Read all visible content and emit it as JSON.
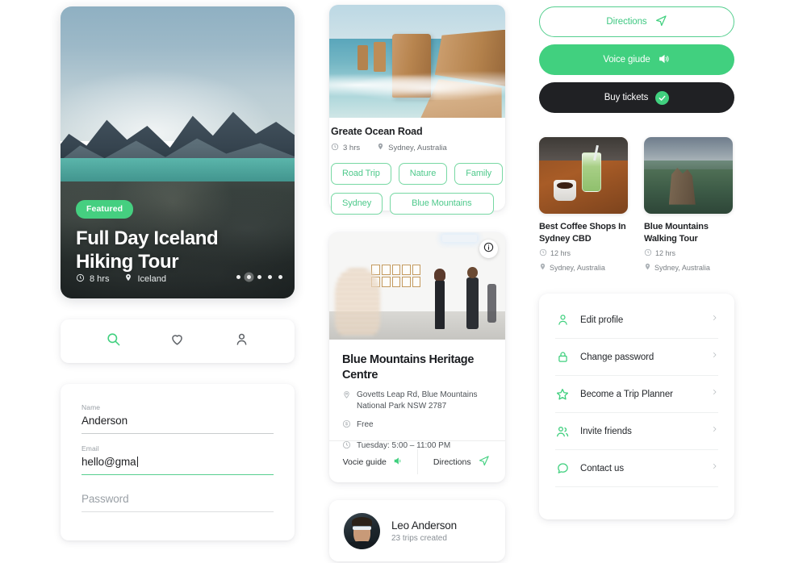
{
  "hero": {
    "badge": "Featured",
    "title": "Full Day Iceland Hiking Tour",
    "duration": "8 hrs",
    "location": "Iceland",
    "dots": 5,
    "active_dot_index": 1
  },
  "navbar": {
    "items": [
      {
        "name": "search-icon",
        "label": "Search",
        "active": true
      },
      {
        "name": "heart-icon",
        "label": "Favorites",
        "active": false
      },
      {
        "name": "person-icon",
        "label": "Profile",
        "active": false
      }
    ]
  },
  "form": {
    "name_label": "Name",
    "name_value": "Anderson",
    "email_label": "Email",
    "email_value": "hello@gma",
    "password_placeholder": "Password"
  },
  "great_ocean_road": {
    "title": "Greate Ocean Road",
    "duration": "3 hrs",
    "location": "Sydney, Australia",
    "tags_row1": [
      "Road Trip",
      "Nature",
      "Family"
    ],
    "tags_row2": [
      "Sydney",
      "Blue Mountains"
    ]
  },
  "heritage": {
    "title": "Blue Mountains Heritage Centre",
    "address": "Govetts Leap Rd, Blue Mountains National Park NSW 2787",
    "price": "Free",
    "hours": "Tuesday: 5:00 – 11:00 PM",
    "action_voice": "Vocie guide",
    "action_directions": "Directions"
  },
  "profile": {
    "name": "Leo Anderson",
    "subtitle": "23 trips created"
  },
  "actions": {
    "directions": "Directions",
    "voice_guide": "Voice giude",
    "buy_tickets": "Buy tickets"
  },
  "thumbs": [
    {
      "title": "Best Coffee Shops In Sydney CBD",
      "duration": "12 hrs",
      "location": "Sydney, Australia"
    },
    {
      "title": "Blue Mountains Walking Tour",
      "duration": "12 hrs",
      "location": "Sydney, Australia"
    }
  ],
  "menu": {
    "items": [
      {
        "label": "Edit profile",
        "icon": "person-icon"
      },
      {
        "label": "Change password",
        "icon": "lock-icon"
      },
      {
        "label": "Become a Trip Planner",
        "icon": "star-icon"
      },
      {
        "label": "Invite friends",
        "icon": "people-icon"
      },
      {
        "label": "Contact us",
        "icon": "chat-icon"
      }
    ]
  },
  "colors": {
    "accent_green": "#41d07f",
    "accent_green_light": "#55cf8f",
    "dark": "#202124",
    "text_muted": "#7b8085",
    "background": "#ffffff"
  }
}
